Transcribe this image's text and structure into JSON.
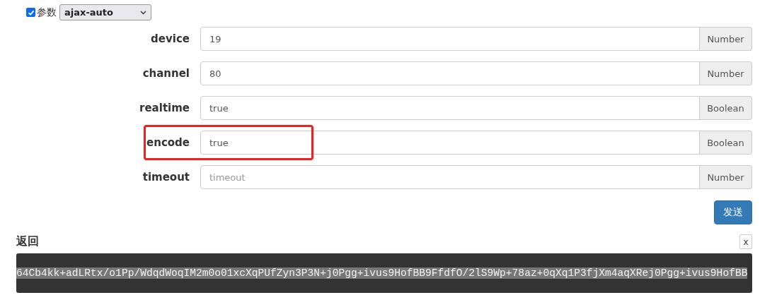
{
  "params_toggle": {
    "label": "参数",
    "checked": true
  },
  "mode_select": {
    "value": "ajax-auto"
  },
  "params": [
    {
      "name": "device",
      "value": "19",
      "type": "Number",
      "highlighted": false
    },
    {
      "name": "channel",
      "value": "80",
      "type": "Number",
      "highlighted": false
    },
    {
      "name": "realtime",
      "value": "true",
      "type": "Boolean",
      "highlighted": false
    },
    {
      "name": "encode",
      "value": "true",
      "type": "Boolean",
      "highlighted": true
    },
    {
      "name": "timeout",
      "placeholder": "timeout",
      "type": "Number",
      "highlighted": false
    }
  ],
  "send_button": "发送",
  "response": {
    "title": "返回",
    "close": "x",
    "output": "64Cb4kk+adLRtx/o1Pp/WdqdWoqIM2m0o01xcXqPUfZyn3P3N+j0Pgg+ivus9HofBB9FfdfO/2lS9Wp+78az+0qXq1P3fjXm4aqXRej0Pgg+ivus9HofBB"
  }
}
